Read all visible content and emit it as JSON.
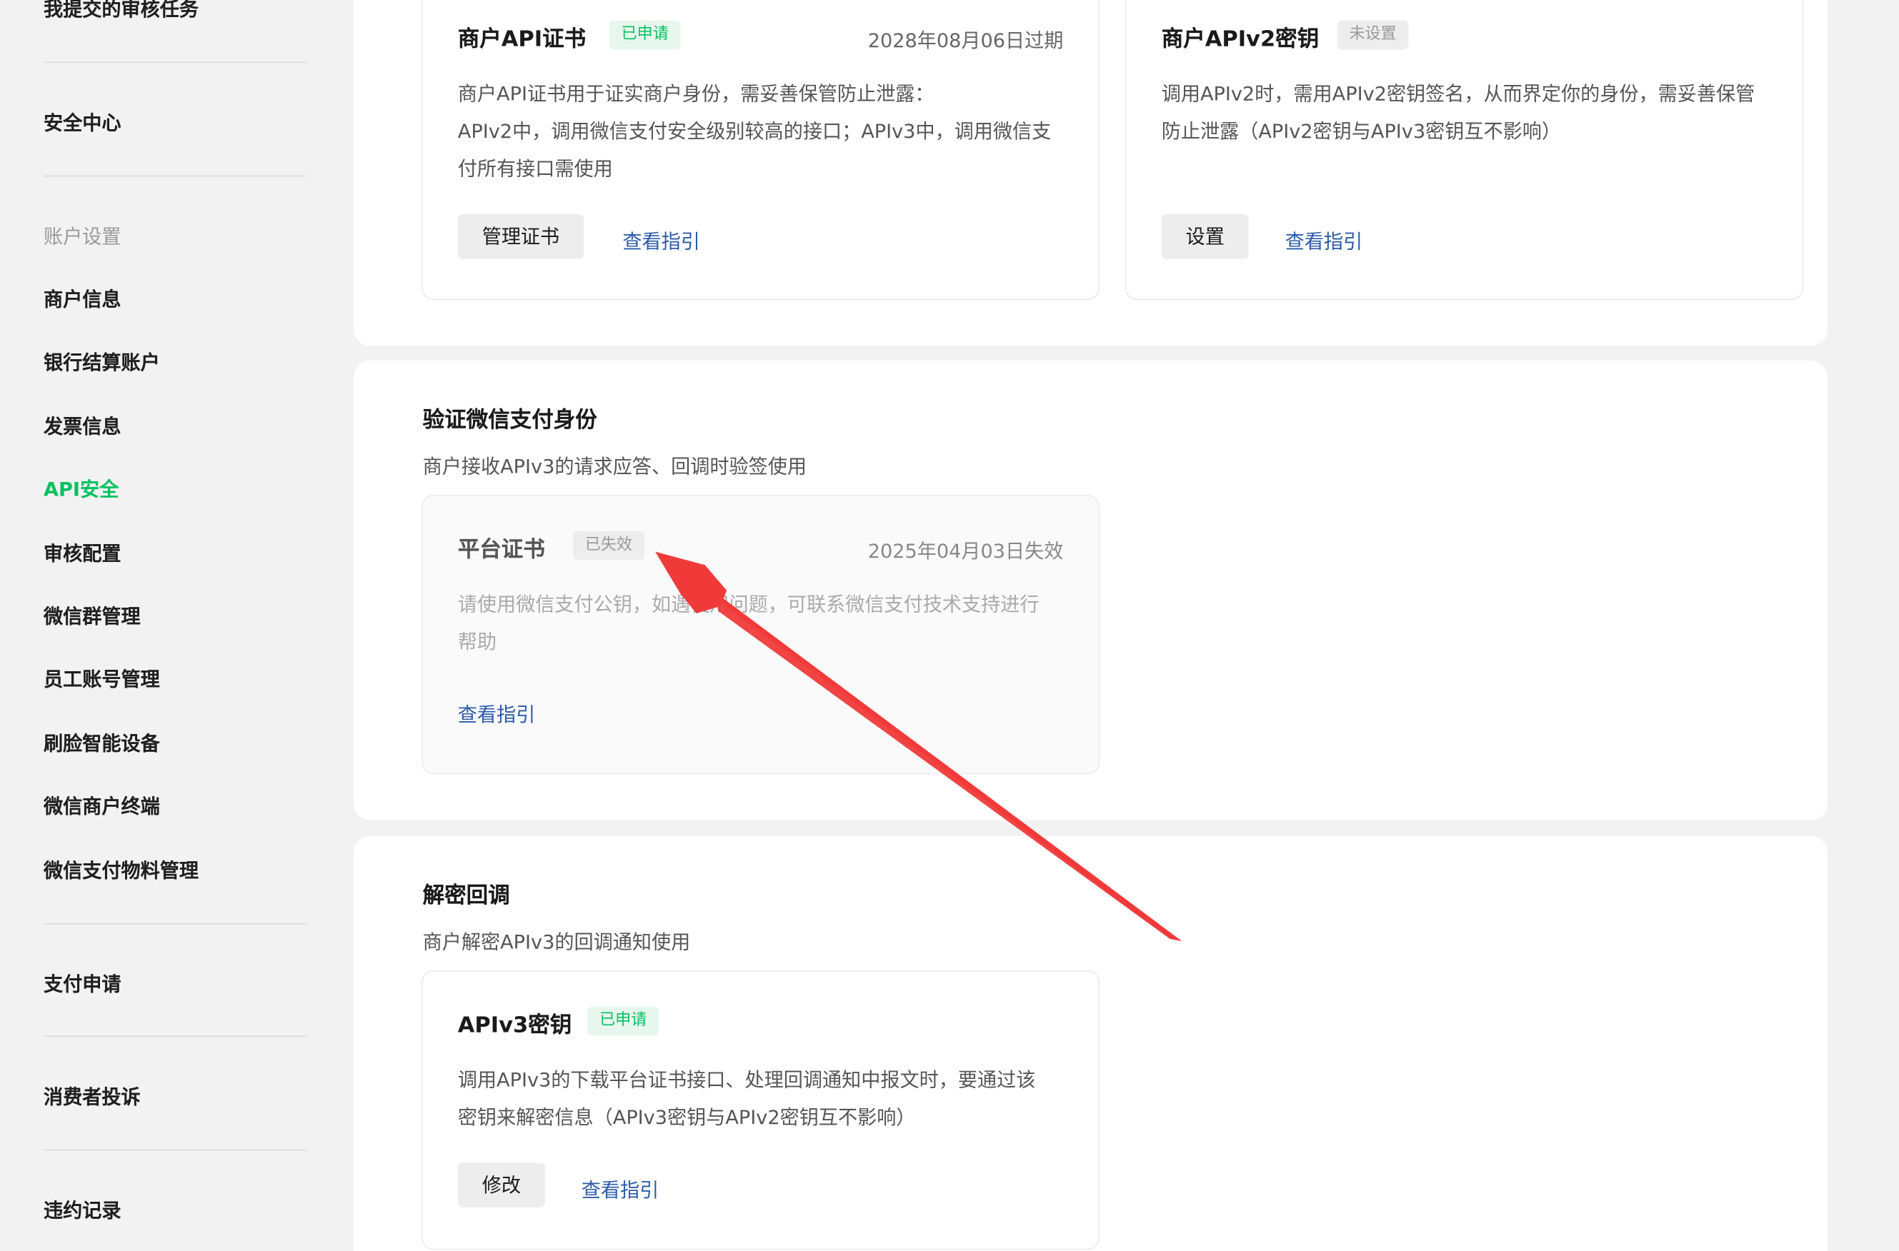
{
  "sidebar": {
    "items": [
      {
        "label": "我提交的审核任务"
      },
      {
        "label": "安全中心"
      },
      {
        "label": "账户设置"
      },
      {
        "label": "商户信息"
      },
      {
        "label": "银行结算账户"
      },
      {
        "label": "发票信息"
      },
      {
        "label": "API安全"
      },
      {
        "label": "审核配置"
      },
      {
        "label": "微信群管理"
      },
      {
        "label": "员工账号管理"
      },
      {
        "label": "刷脸智能设备"
      },
      {
        "label": "微信商户终端"
      },
      {
        "label": "微信支付物料管理"
      },
      {
        "label": "支付申请"
      },
      {
        "label": "消费者投诉"
      },
      {
        "label": "违约记录"
      }
    ],
    "active_item": "API安全"
  },
  "api_cert_card": {
    "title": "商户API证书",
    "badge": "已申请",
    "date": "2028年08月06日过期",
    "desc_line1": "商户API证书用于证实商户身份，需妥善保管防止泄露：",
    "desc_line2": "APIv2中，调用微信支付安全级别较高的接口；APIv3中，调用微信支",
    "desc_line3": "付所有接口需使用",
    "button": "管理证书",
    "link": "查看指引"
  },
  "apiv2_card": {
    "title": "商户APIv2密钥",
    "badge": "未设置",
    "desc_line1": "调用APIv2时，需用APIv2密钥签名，从而界定你的身份，需妥善保管",
    "desc_line2": "防止泄露（APIv2密钥与APIv3密钥互不影响）",
    "button": "设置",
    "link": "查看指引"
  },
  "verify_section": {
    "title": "验证微信支付身份",
    "subtitle": "商户接收APIv3的请求应答、回调时验签使用",
    "card": {
      "title": "平台证书",
      "badge": "已失效",
      "date": "2025年04月03日失效",
      "desc_line1": "请使用微信支付公钥，如遇使用问题，可联系微信支付技术支持进行",
      "desc_line2": "帮助",
      "link": "查看指引"
    }
  },
  "decrypt_section": {
    "title": "解密回调",
    "subtitle": "商户解密APIv3的回调通知使用",
    "card": {
      "title": "APIv3密钥",
      "badge": "已申请",
      "desc_line1": "调用APIv3的下载平台证书接口、处理回调通知中报文时，要通过该",
      "desc_line2": "密钥来解密信息（APIv3密钥与APIv2密钥互不影响）",
      "button": "修改",
      "link": "查看指引"
    }
  },
  "colors": {
    "accent_green": "#07c160",
    "link_blue": "#2b5aa8",
    "annotation_red": "#f03a3a"
  }
}
